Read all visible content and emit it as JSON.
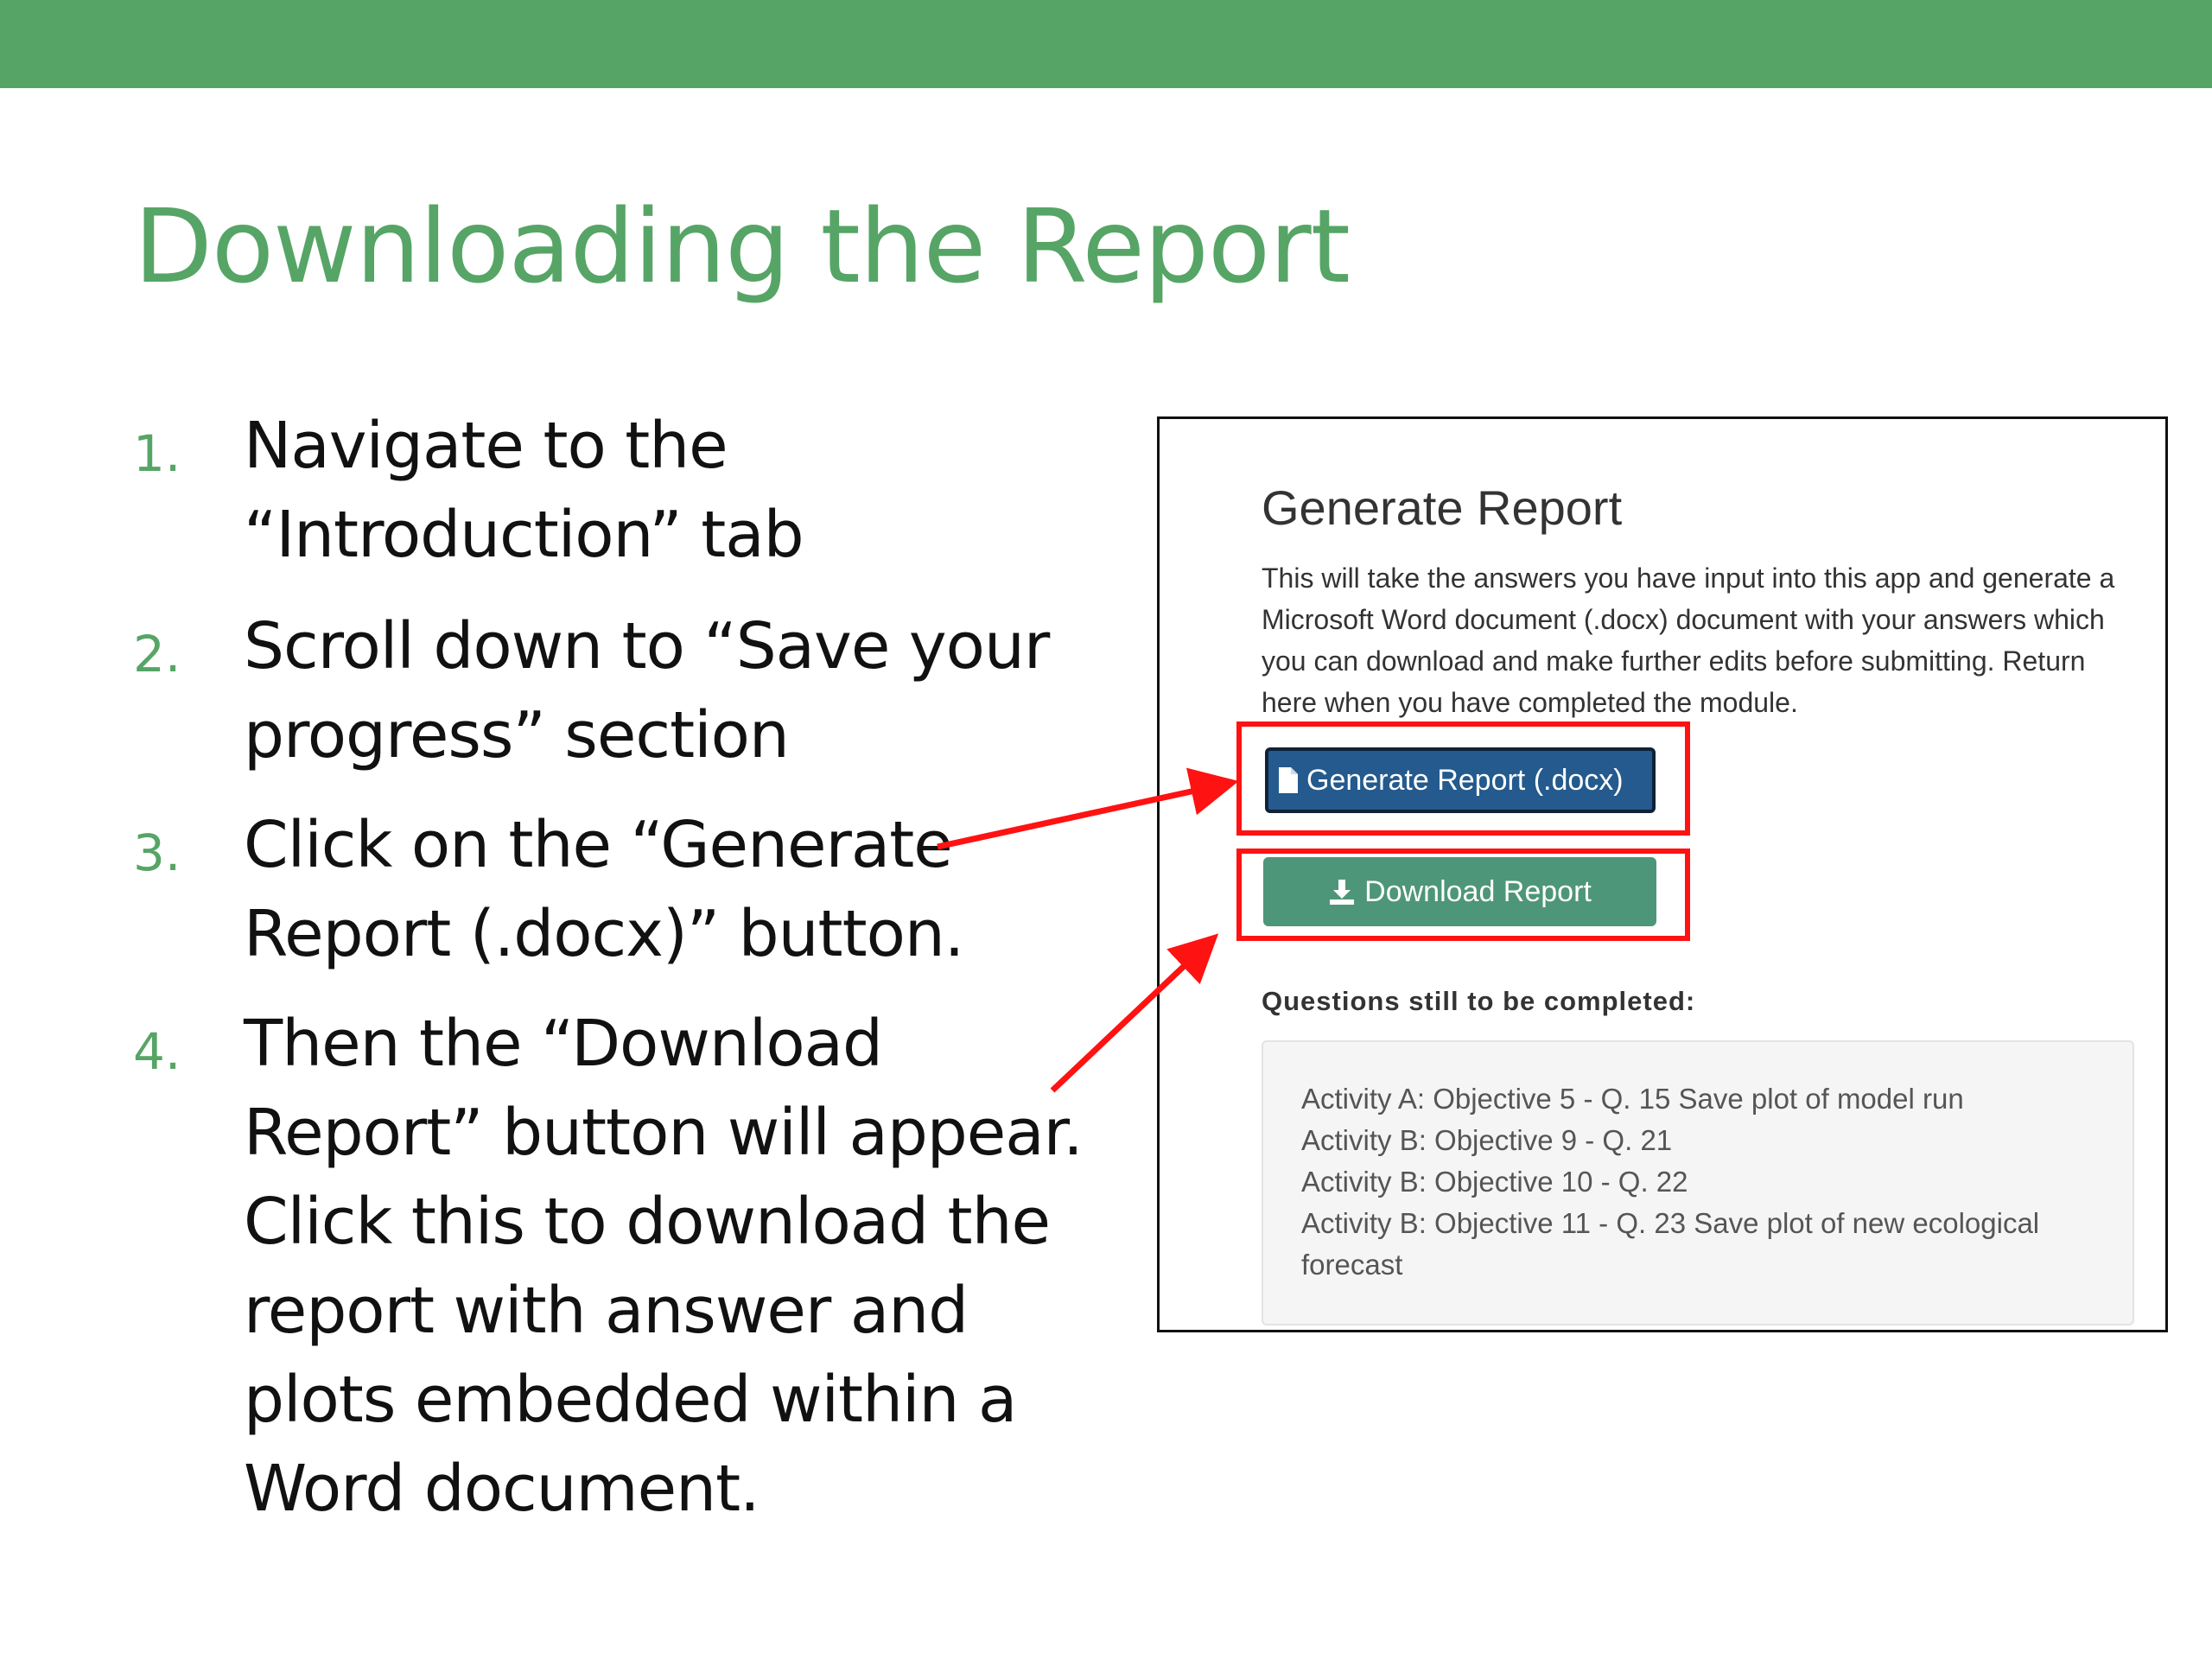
{
  "slide": {
    "title": "Downloading the Report"
  },
  "steps": [
    {
      "number": "1.",
      "text": "Navigate to the “Introduction” tab"
    },
    {
      "number": "2.",
      "text": "Scroll down to “Save your progress” section"
    },
    {
      "number": "3.",
      "text": "Click on the “Generate Report (.docx)” button."
    },
    {
      "number": "4.",
      "text": "Then the “Download Report” button will appear. Click this to download the report with answer and plots embedded within a Word document."
    }
  ],
  "screenshot": {
    "title": "Generate Report",
    "description": "This will take the answers you have input into this app and generate a Microsoft Word document (.docx) document with your answers which you can download and make further edits before submitting. Return here when you have completed the module.",
    "generate_button": {
      "label": "Generate Report (.docx)",
      "icon": "file-icon"
    },
    "download_button": {
      "label": "Download Report",
      "icon": "download-icon"
    },
    "questions_heading": "Questions still to be completed:",
    "questions": [
      "Activity A: Objective 5 - Q. 15 Save plot of model run",
      "Activity B: Objective 9 - Q. 21",
      "Activity B: Objective 10 - Q. 22",
      "Activity B: Objective 11 - Q. 23 Save plot of new ecological forecast"
    ]
  },
  "colors": {
    "accent_green": "#56a566",
    "highlight_red": "#ff1212",
    "generate_blue": "#245a8d",
    "download_green": "#4e9679"
  }
}
